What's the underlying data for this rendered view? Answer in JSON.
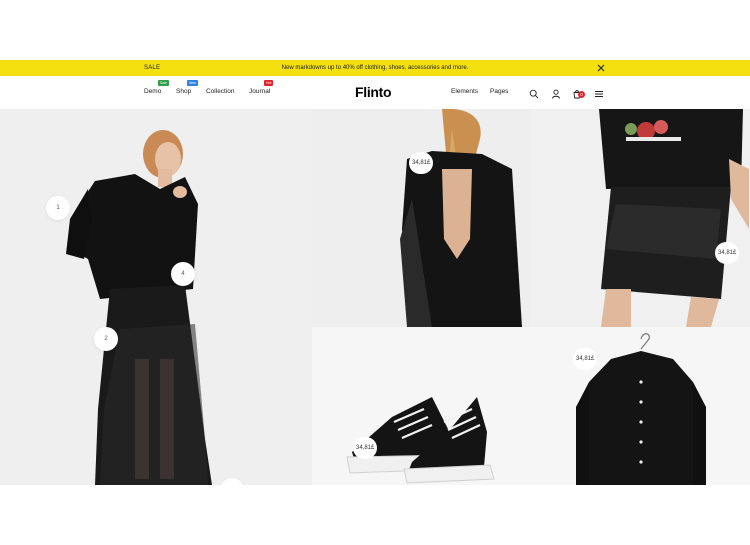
{
  "announcement": {
    "label": "SALE",
    "message": "New markdowns up to 40% off clothing, shoes, accessories and more."
  },
  "header": {
    "logo": "Flinto",
    "nav_left": [
      {
        "label": "Demo",
        "badge": "Sale",
        "badge_color": "#2e9e47"
      },
      {
        "label": "Shop",
        "badge": "New",
        "badge_color": "#2f7fe8"
      },
      {
        "label": "Collection",
        "badge": "",
        "badge_color": ""
      },
      {
        "label": "Journal",
        "badge": "Hot",
        "badge_color": "#e4202b"
      }
    ],
    "nav_right": [
      {
        "label": "Elements"
      },
      {
        "label": "Pages"
      }
    ],
    "icons": [
      "search-icon",
      "user-icon",
      "cart-icon",
      "menu-icon"
    ],
    "cart_count": "0"
  },
  "hero": {
    "hotspots": [
      "1",
      "2",
      "4"
    ],
    "prices": [
      "34,81£",
      "34,81£",
      "34,81£",
      "34,81£"
    ]
  },
  "colors": {
    "accent_yellow": "#f4e00f",
    "badge_red": "#e4202b",
    "badge_green": "#2e9e47",
    "badge_blue": "#2f7fe8"
  }
}
